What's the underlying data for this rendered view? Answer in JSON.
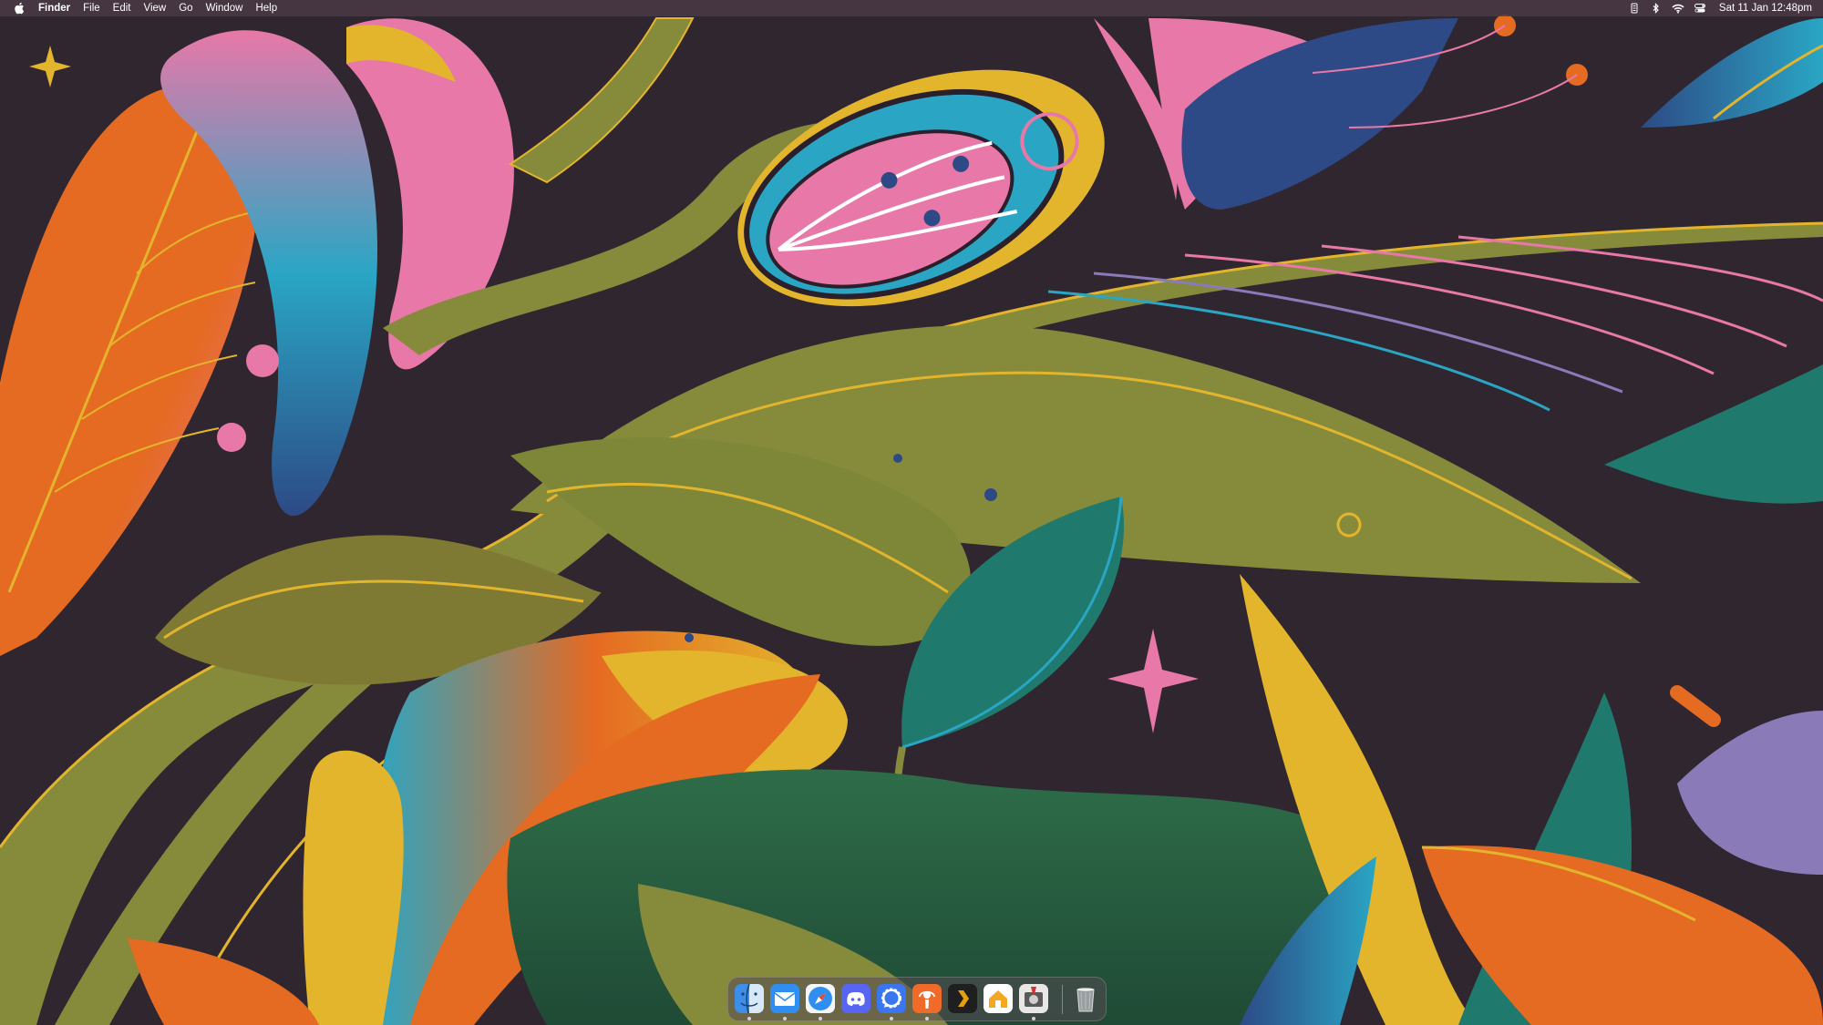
{
  "menubar": {
    "apple_icon": "apple-logo-icon",
    "app_name": "Finder",
    "menus": [
      "File",
      "Edit",
      "View",
      "Go",
      "Window",
      "Help"
    ],
    "status_icons": [
      "battery-case-icon",
      "bluetooth-icon",
      "wifi-icon",
      "control-center-icon"
    ],
    "clock": "Sat 11 Jan  12:48pm"
  },
  "dock": {
    "apps": [
      {
        "name": "finder-icon",
        "running": true
      },
      {
        "name": "mail-icon",
        "running": true
      },
      {
        "name": "safari-icon",
        "running": true
      },
      {
        "name": "discord-icon",
        "running": false
      },
      {
        "name": "signal-icon",
        "running": true
      },
      {
        "name": "podcast-app-icon",
        "running": true
      },
      {
        "name": "plex-icon",
        "running": false
      },
      {
        "name": "home-icon",
        "running": false
      },
      {
        "name": "disk-utility-icon",
        "running": true
      }
    ],
    "trash": "trash-icon"
  },
  "colors": {
    "background": "#30262f",
    "olive": "#868b3c",
    "gold": "#e3b52c",
    "pink": "#e878a8",
    "orange": "#e56a22",
    "teal": "#2aa6c4",
    "green": "#2e6d49",
    "navy": "#2d4a86"
  }
}
